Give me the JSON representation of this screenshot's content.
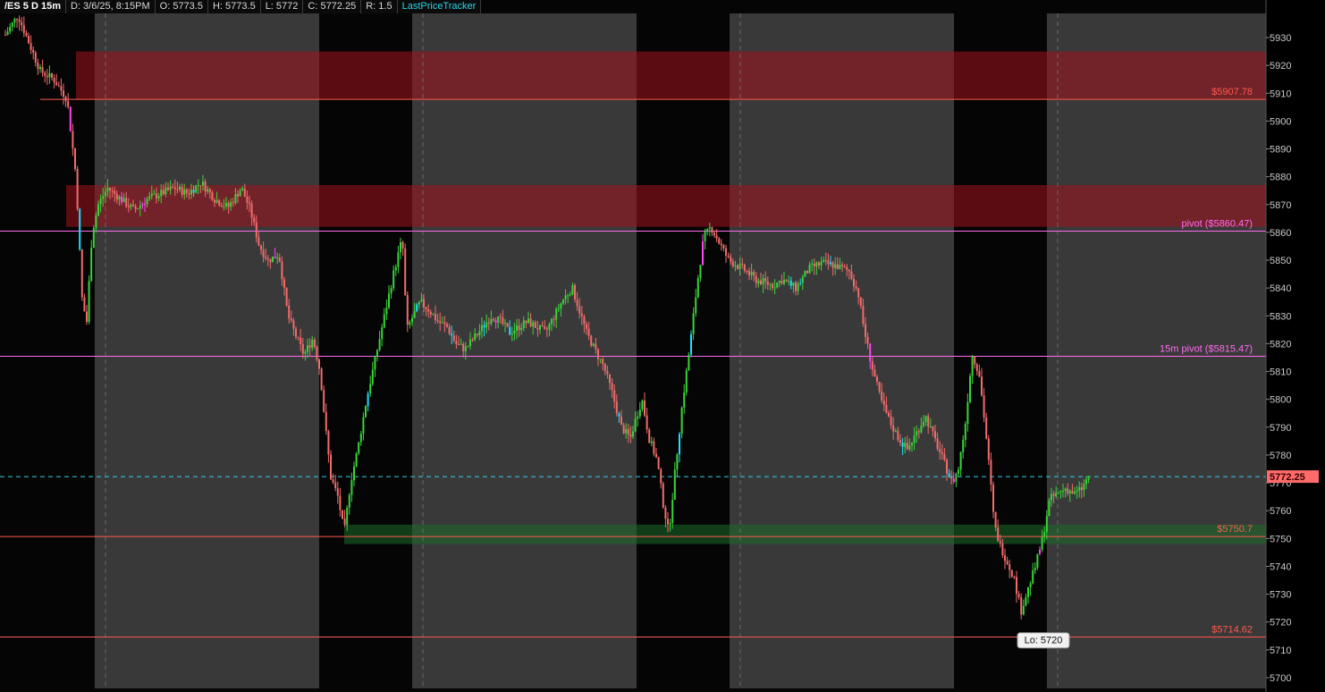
{
  "header": {
    "symbol": "/ES 5 D 15m",
    "date": "D: 3/6/25, 8:15PM",
    "open": "O: 5773.5",
    "high": "H: 5773.5",
    "low": "L: 5772",
    "close": "C: 5772.25",
    "range": "R: 1.5",
    "study": "LastPriceTracker"
  },
  "chart_data": {
    "type": "candlestick",
    "symbol": "/ES",
    "timeframe": "15m",
    "y_axis": {
      "min": 5700,
      "max": 5930,
      "step": 10,
      "ticks": [
        5700,
        5710,
        5720,
        5730,
        5740,
        5750,
        5760,
        5770,
        5780,
        5790,
        5800,
        5810,
        5820,
        5830,
        5840,
        5850,
        5860,
        5870,
        5880,
        5890,
        5900,
        5910,
        5920,
        5930
      ]
    },
    "last_price": {
      "value": 5772.25,
      "label": "5772.25",
      "color": "#ff6b6b"
    },
    "levels": [
      {
        "price": 5907.78,
        "label": "$5907.78",
        "color": "#ff5a4e"
      },
      {
        "price": 5860.47,
        "label": "pivot ($5860.47)",
        "color": "#ff6cf0"
      },
      {
        "price": 5815.47,
        "label": "15m pivot ($5815.47)",
        "color": "#ff6cf0"
      },
      {
        "price": 5750.7,
        "label": "$5750.7",
        "color": "#ff5a4e"
      },
      {
        "price": 5714.62,
        "label": "$5714.62",
        "color": "#ff5a4e"
      }
    ],
    "zones": [
      {
        "from": 5907.78,
        "to": 5925,
        "color": "#a0121e",
        "type": "resistance"
      },
      {
        "from": 5862,
        "to": 5877,
        "color": "#a0121e",
        "type": "resistance"
      },
      {
        "from": 5748,
        "to": 5755,
        "color": "#1e6b2a",
        "type": "support"
      }
    ],
    "low_marker": {
      "label": "Lo: 5720",
      "price": 5720
    },
    "session_shading": {
      "regular_color": "#393939",
      "overnight_color": "#050505"
    },
    "colors": {
      "up": "#3ad43a",
      "down": "#f26c6c",
      "accent_down": "#1fe0ff",
      "accent_up": "#ff44ee",
      "last_price_line": "#2fd3e8"
    },
    "anchors": [
      [
        0,
        5928
      ],
      [
        20,
        5938
      ],
      [
        45,
        5918
      ],
      [
        60,
        5915
      ],
      [
        75,
        5908
      ],
      [
        85,
        5880
      ],
      [
        92,
        5835
      ],
      [
        97,
        5828
      ],
      [
        103,
        5860
      ],
      [
        110,
        5870
      ],
      [
        120,
        5876
      ],
      [
        135,
        5872
      ],
      [
        150,
        5868
      ],
      [
        165,
        5872
      ],
      [
        180,
        5874
      ],
      [
        195,
        5876
      ],
      [
        210,
        5874
      ],
      [
        225,
        5878
      ],
      [
        240,
        5872
      ],
      [
        255,
        5869
      ],
      [
        270,
        5876
      ],
      [
        280,
        5868
      ],
      [
        290,
        5855
      ],
      [
        300,
        5850
      ],
      [
        312,
        5852
      ],
      [
        322,
        5830
      ],
      [
        332,
        5822
      ],
      [
        340,
        5816
      ],
      [
        350,
        5822
      ],
      [
        358,
        5810
      ],
      [
        364,
        5790
      ],
      [
        370,
        5772
      ],
      [
        378,
        5765
      ],
      [
        385,
        5752
      ],
      [
        392,
        5770
      ],
      [
        400,
        5782
      ],
      [
        410,
        5800
      ],
      [
        420,
        5815
      ],
      [
        430,
        5830
      ],
      [
        440,
        5845
      ],
      [
        450,
        5858
      ],
      [
        455,
        5825
      ],
      [
        462,
        5830
      ],
      [
        470,
        5835
      ],
      [
        480,
        5832
      ],
      [
        490,
        5828
      ],
      [
        500,
        5826
      ],
      [
        510,
        5820
      ],
      [
        520,
        5818
      ],
      [
        530,
        5822
      ],
      [
        540,
        5826
      ],
      [
        550,
        5830
      ],
      [
        560,
        5828
      ],
      [
        570,
        5824
      ],
      [
        580,
        5826
      ],
      [
        590,
        5828
      ],
      [
        600,
        5826
      ],
      [
        610,
        5824
      ],
      [
        620,
        5830
      ],
      [
        630,
        5836
      ],
      [
        640,
        5840
      ],
      [
        648,
        5832
      ],
      [
        656,
        5824
      ],
      [
        665,
        5818
      ],
      [
        675,
        5812
      ],
      [
        685,
        5802
      ],
      [
        695,
        5790
      ],
      [
        705,
        5786
      ],
      [
        712,
        5794
      ],
      [
        718,
        5800
      ],
      [
        726,
        5786
      ],
      [
        735,
        5778
      ],
      [
        742,
        5762
      ],
      [
        748,
        5752
      ],
      [
        755,
        5774
      ],
      [
        763,
        5798
      ],
      [
        772,
        5820
      ],
      [
        780,
        5842
      ],
      [
        787,
        5858
      ],
      [
        795,
        5862
      ],
      [
        805,
        5856
      ],
      [
        815,
        5850
      ],
      [
        825,
        5848
      ],
      [
        835,
        5846
      ],
      [
        845,
        5843
      ],
      [
        855,
        5842
      ],
      [
        865,
        5841
      ],
      [
        875,
        5843
      ],
      [
        890,
        5840
      ],
      [
        905,
        5847
      ],
      [
        920,
        5849
      ],
      [
        935,
        5848
      ],
      [
        950,
        5846
      ],
      [
        960,
        5838
      ],
      [
        966,
        5826
      ],
      [
        975,
        5812
      ],
      [
        985,
        5800
      ],
      [
        995,
        5792
      ],
      [
        1005,
        5786
      ],
      [
        1015,
        5782
      ],
      [
        1025,
        5788
      ],
      [
        1035,
        5794
      ],
      [
        1045,
        5786
      ],
      [
        1055,
        5778
      ],
      [
        1065,
        5770
      ],
      [
        1072,
        5775
      ],
      [
        1080,
        5792
      ],
      [
        1087,
        5816
      ],
      [
        1095,
        5810
      ],
      [
        1102,
        5790
      ],
      [
        1108,
        5770
      ],
      [
        1112,
        5755
      ],
      [
        1118,
        5748
      ],
      [
        1126,
        5742
      ],
      [
        1134,
        5736
      ],
      [
        1142,
        5724
      ],
      [
        1150,
        5732
      ],
      [
        1158,
        5740
      ],
      [
        1166,
        5750
      ],
      [
        1174,
        5764
      ],
      [
        1182,
        5766
      ],
      [
        1192,
        5768
      ],
      [
        1202,
        5766
      ],
      [
        1210,
        5768
      ],
      [
        1218,
        5772.25
      ]
    ]
  }
}
